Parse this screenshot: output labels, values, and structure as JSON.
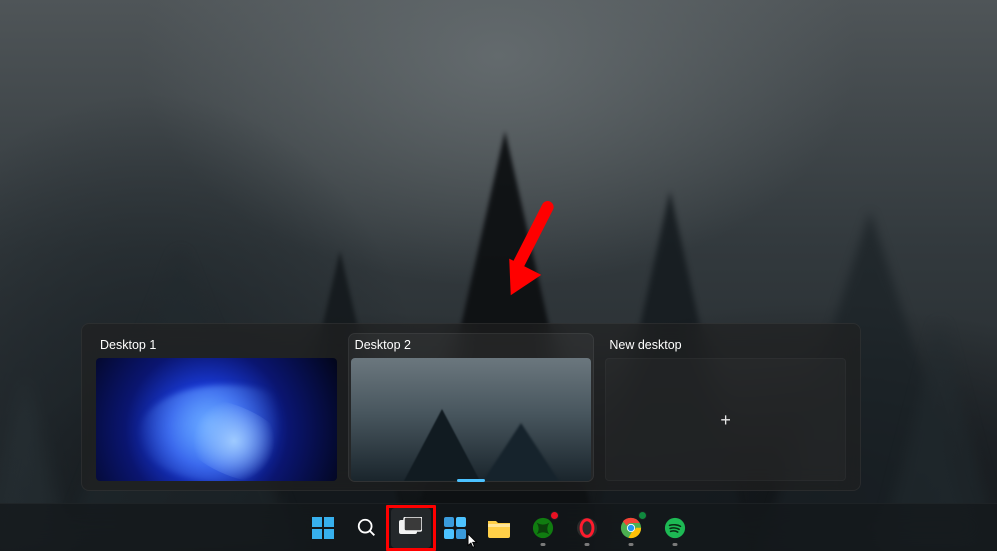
{
  "desktops": {
    "items": [
      {
        "label": "Desktop 1",
        "active": false,
        "thumb": "bloom"
      },
      {
        "label": "Desktop 2",
        "active": true,
        "thumb": "forest"
      }
    ],
    "new_label": "New desktop",
    "new_glyph": "+"
  },
  "taskbar": {
    "items": [
      {
        "name": "start",
        "icon": "start-icon",
        "open": false,
        "badge": null
      },
      {
        "name": "search",
        "icon": "search-icon",
        "open": false,
        "badge": null
      },
      {
        "name": "task-view",
        "icon": "task-view-icon",
        "open": false,
        "badge": null,
        "active_highlight": true
      },
      {
        "name": "widgets",
        "icon": "widgets-icon",
        "open": false,
        "badge": null
      },
      {
        "name": "file-explorer",
        "icon": "file-explorer-icon",
        "open": false,
        "badge": null
      },
      {
        "name": "xbox",
        "icon": "xbox-icon",
        "open": true,
        "badge": "red"
      },
      {
        "name": "opera",
        "icon": "opera-icon",
        "open": true,
        "badge": null
      },
      {
        "name": "chrome",
        "icon": "chrome-icon",
        "open": true,
        "badge": "green"
      },
      {
        "name": "spotify",
        "icon": "spotify-icon",
        "open": true,
        "badge": null
      }
    ]
  },
  "annotation": {
    "kind": "arrow",
    "color": "#ff0000"
  },
  "colors": {
    "accent": "#4cc2ff",
    "annotation": "#ff0000"
  }
}
